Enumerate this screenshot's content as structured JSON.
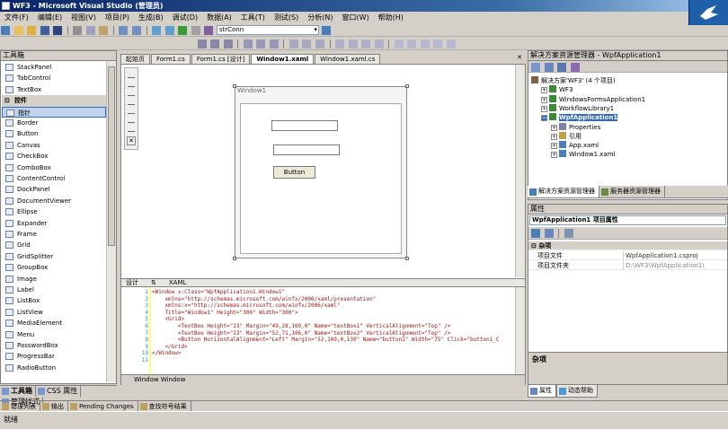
{
  "window": {
    "title": "WF3 - Microsoft Visual Studio (管理员)"
  },
  "menu": [
    "文件(F)",
    "编辑(E)",
    "视图(V)",
    "项目(P)",
    "生成(B)",
    "调试(D)",
    "数据(A)",
    "工具(T)",
    "测试(S)",
    "分析(N)",
    "窗口(W)",
    "帮助(H)"
  ],
  "toolbar": {
    "combo_value": "strConn"
  },
  "toolbox": {
    "title": "工具箱",
    "items": [
      {
        "label": "StackPanel",
        "group": false
      },
      {
        "label": "TabControl",
        "group": false
      },
      {
        "label": "TextBox",
        "group": false
      },
      {
        "label": "控件",
        "group": true
      },
      {
        "label": "指针",
        "group": false,
        "selected": true
      },
      {
        "label": "Border",
        "group": false
      },
      {
        "label": "Button",
        "group": false
      },
      {
        "label": "Canvas",
        "group": false
      },
      {
        "label": "CheckBox",
        "group": false
      },
      {
        "label": "ComboBox",
        "group": false
      },
      {
        "label": "ContentControl",
        "group": false
      },
      {
        "label": "DockPanel",
        "group": false
      },
      {
        "label": "DocumentViewer",
        "group": false
      },
      {
        "label": "Ellipse",
        "group": false
      },
      {
        "label": "Expander",
        "group": false
      },
      {
        "label": "Frame",
        "group": false
      },
      {
        "label": "Grid",
        "group": false
      },
      {
        "label": "GridSplitter",
        "group": false
      },
      {
        "label": "GroupBox",
        "group": false
      },
      {
        "label": "Image",
        "group": false
      },
      {
        "label": "Label",
        "group": false
      },
      {
        "label": "ListBox",
        "group": false
      },
      {
        "label": "ListView",
        "group": false
      },
      {
        "label": "MediaElement",
        "group": false
      },
      {
        "label": "Menu",
        "group": false
      },
      {
        "label": "PasswordBox",
        "group": false
      },
      {
        "label": "ProgressBar",
        "group": false
      },
      {
        "label": "RadioButton",
        "group": false
      }
    ],
    "tabs": [
      "工具箱",
      "CSS 属性",
      "管理样式"
    ]
  },
  "doc_tabs": [
    "起始页",
    "Form1.cs",
    "Form1.cs [设计]",
    "Window1.xaml",
    "Window1.xaml.cs"
  ],
  "designer": {
    "window_title": "Window1",
    "button_label": "Button"
  },
  "split_tabs": [
    "设计",
    "⇅",
    "XAML"
  ],
  "xaml": {
    "line_numbers": [
      "1",
      "2",
      "3",
      "4",
      "5",
      "6",
      "7",
      "8",
      "9",
      "10",
      "11"
    ],
    "lines": [
      "<Window x:Class=\"WpfApplication1.Window1\"",
      "    xmlns=\"http://schemas.microsoft.com/winfx/2006/xaml/presentation\"",
      "    xmlns:x=\"http://schemas.microsoft.com/winfx/2006/xaml\"",
      "    Title=\"Window1\" Height=\"300\" Width=\"300\">",
      "    <Grid>",
      "        <TextBox Height=\"23\" Margin=\"49,28,109,0\" Name=\"textBox1\" VerticalAlignment=\"Top\" />",
      "        <TextBox Height=\"23\" Margin=\"52,71,106,0\" Name=\"textBox2\" VerticalAlignment=\"Top\" />",
      "        <Button HorizontalAlignment=\"Left\" Margin=\"52,109,0,130\" Name=\"button1\" Width=\"75\" Click=\"button1_C",
      "    </Grid>",
      "</Window>",
      ""
    ]
  },
  "editor_status": "Window  Window",
  "solution": {
    "title": "解决方案资源管理器 - WpfApplication1",
    "tree": [
      {
        "label": "解决方案'WF3' (4 个项目)",
        "indent": 0
      },
      {
        "label": "WF3",
        "indent": 1
      },
      {
        "label": "WindowsFormsApplication1",
        "indent": 1
      },
      {
        "label": "WorkflowLibrary1",
        "indent": 1
      },
      {
        "label": "WpfApplication1",
        "indent": 1,
        "selected": true
      },
      {
        "label": "Properties",
        "indent": 2
      },
      {
        "label": "引用",
        "indent": 2
      },
      {
        "label": "App.xaml",
        "indent": 2
      },
      {
        "label": "Window1.xaml",
        "indent": 2
      }
    ],
    "tabs": [
      "解决方案资源管理器",
      "服务器资源管理器"
    ]
  },
  "properties": {
    "title": "属性",
    "combo": "WpfApplication1 项目属性",
    "category": "杂项",
    "rows": [
      {
        "key": "项目文件",
        "value": "WpfApplication1.csproj"
      },
      {
        "key": "项目文件夹",
        "value": "D:\\WF3\\WpfApplication1\\"
      }
    ],
    "description": "杂项",
    "tabs": [
      "属性",
      "动态帮助"
    ]
  },
  "output_tabs": [
    "错误列表",
    "输出",
    "Pending Changes",
    "查找符号结果"
  ],
  "status": "就绪"
}
